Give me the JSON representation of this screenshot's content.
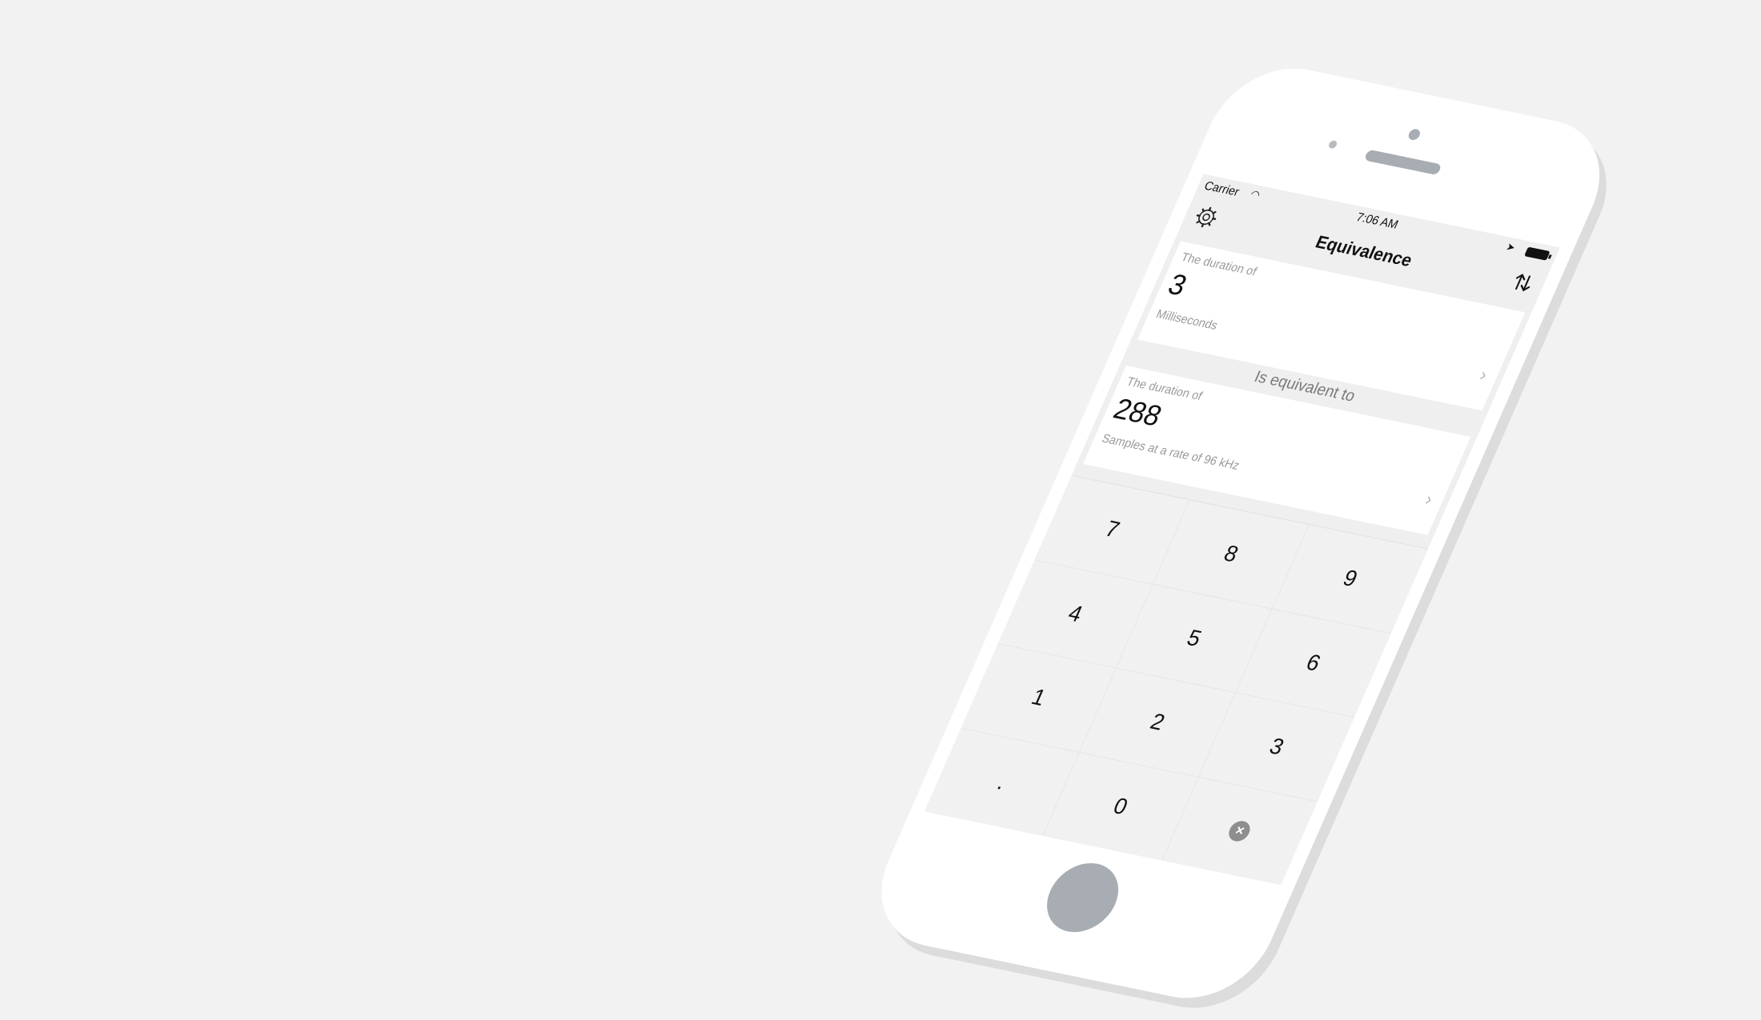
{
  "status_bar": {
    "carrier": "Carrier",
    "time": "7:06 AM"
  },
  "nav": {
    "title": "Equivalence",
    "settings_icon": "gear-icon",
    "swap_icon": "swap-arrows-icon"
  },
  "source": {
    "caption": "The duration of",
    "value": "3",
    "unit": "Milliseconds"
  },
  "equivalent_label": "Is equivalent to",
  "target": {
    "caption": "The duration of",
    "value": "288",
    "unit": "Samples at a rate of 96 kHz"
  },
  "keypad": {
    "keys": [
      "7",
      "8",
      "9",
      "4",
      "5",
      "6",
      "1",
      "2",
      "3",
      ".",
      "0"
    ],
    "delete_icon": "delete-icon"
  }
}
